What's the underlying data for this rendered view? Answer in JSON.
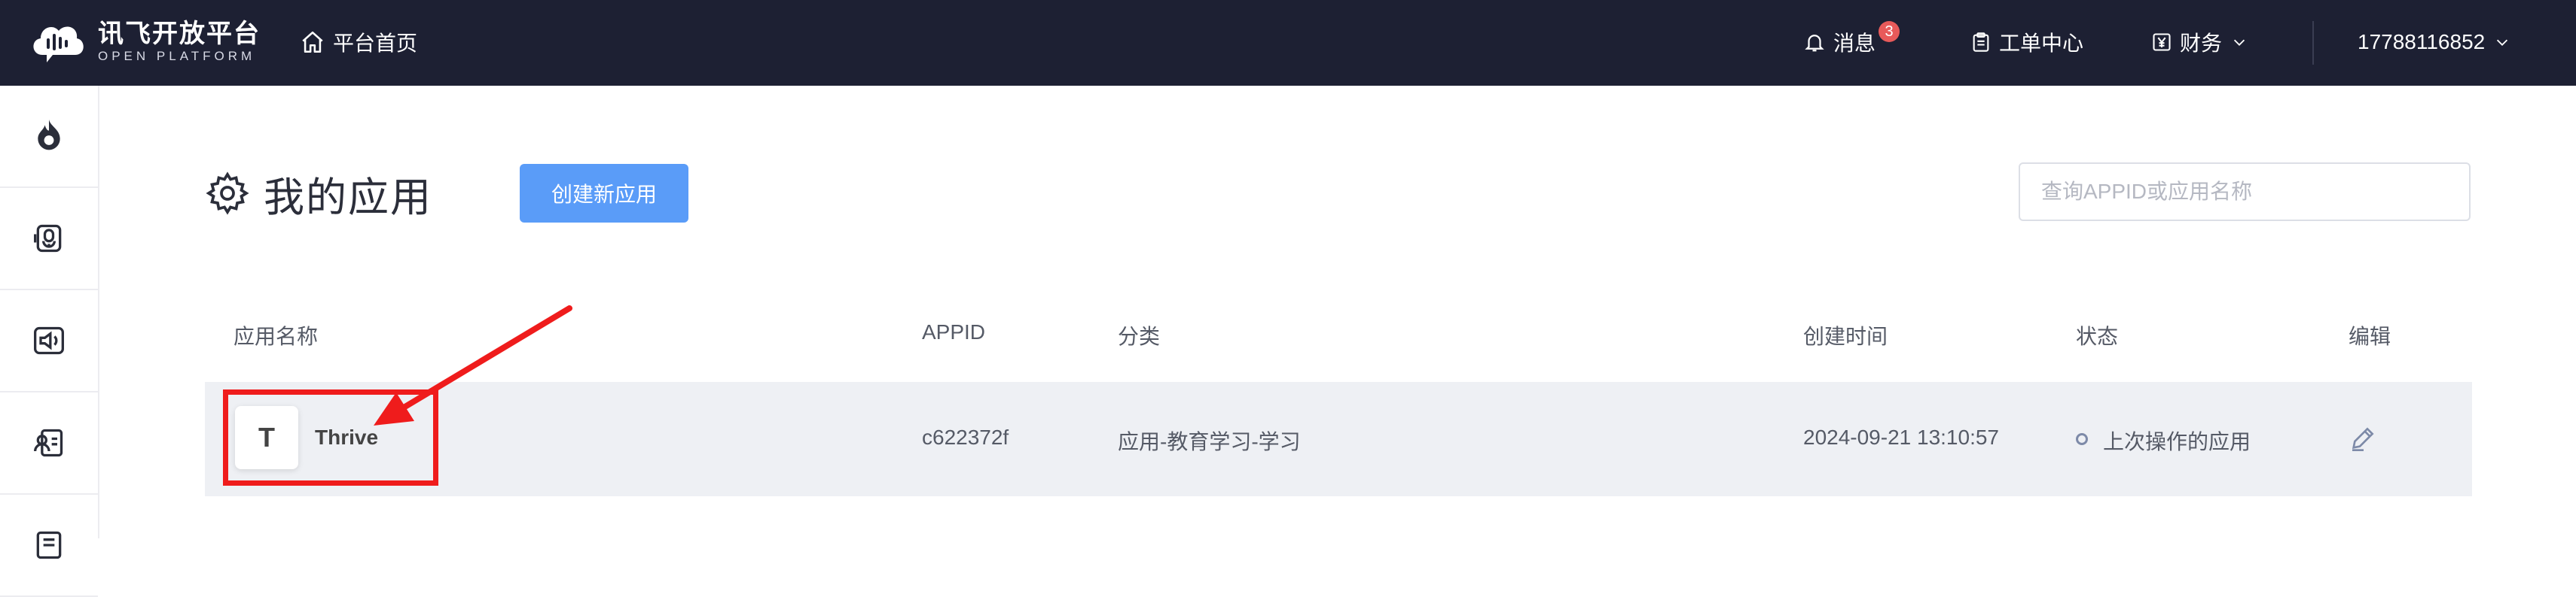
{
  "brand": {
    "name_cn": "讯飞开放平台",
    "name_en": "OPEN PLATFORM"
  },
  "topnav": {
    "home_label": "平台首页",
    "messages_label": "消息",
    "messages_count": "3",
    "tickets_label": "工单中心",
    "finance_label": "财务",
    "account_label": "17788116852"
  },
  "sidebar": {
    "items": [
      {
        "icon": "flame-icon"
      },
      {
        "icon": "voice-recorder-icon"
      },
      {
        "icon": "speaker-icon"
      },
      {
        "icon": "person-id-icon"
      },
      {
        "icon": "document-icon"
      }
    ]
  },
  "main": {
    "title": "我的应用",
    "create_button": "创建新应用",
    "search_placeholder": "查询APPID或应用名称"
  },
  "table": {
    "headers": {
      "name": "应用名称",
      "appid": "APPID",
      "category": "分类",
      "created": "创建时间",
      "status": "状态",
      "edit": "编辑"
    },
    "rows": [
      {
        "avatar_letter": "T",
        "name": "Thrive",
        "appid": "c622372f",
        "category": "应用-教育学习-学习",
        "created": "2024-09-21 13:10:57",
        "status": "上次操作的应用"
      }
    ]
  },
  "colors": {
    "topbar": "#1d2033",
    "primary": "#5a9cf8",
    "badge": "#e85a5a",
    "annotation": "#ef1c1c",
    "row_bg": "#eef0f4"
  }
}
